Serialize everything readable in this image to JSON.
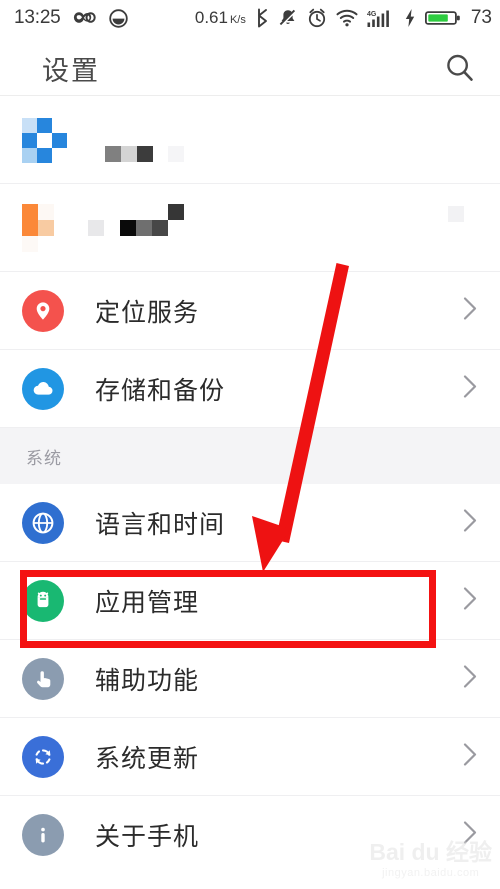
{
  "statusbar": {
    "clock": "13:25",
    "left_icons": [
      "infinity-icon",
      "smiley-icon"
    ],
    "net_speed": "0.61",
    "net_speed_unit": "K/s",
    "right_icons": [
      "bluetooth-icon",
      "mute-icon",
      "alarm-icon",
      "wifi-icon",
      "signal-4g-icon",
      "charging-bolt-icon"
    ],
    "signal_label": "4G",
    "battery_percent": "73",
    "battery_color": "#2ecc40"
  },
  "titlebar": {
    "title": "设置",
    "search_icon": "search-icon"
  },
  "list": [
    {
      "kind": "mosaic",
      "name": "censored-row-1",
      "icon_colors": [
        "#c8e0f7",
        "#2786dd",
        "#ffffff",
        "#2786dd",
        "#ffffff",
        "#2786dd",
        "#a9d1f2",
        "#2786dd",
        "#ffffff"
      ],
      "text_blocks": [
        "#808080",
        "#d4d4d4",
        "#3c3c3c",
        "#f5f5f7"
      ]
    },
    {
      "kind": "mosaic",
      "name": "censored-row-2",
      "icon_colors": [
        "#fb8838",
        "#fdf8f4",
        "#ffffff",
        "#fb8838",
        "#f8cba2",
        "#ffffff",
        "#fdf9f6",
        "#ffffff",
        "#ffffff"
      ],
      "text_blocks": [
        "#e8e8ea",
        "#0a0a0a",
        "#6f6f6f",
        "#474747",
        "#363636"
      ],
      "chevron_block": "#f2f2f4"
    },
    {
      "kind": "item",
      "name": "location-services",
      "label": "定位服务",
      "icon": "location-pin-icon",
      "icon_bg": "#f4524d",
      "chevron": "chevron-right-icon"
    },
    {
      "kind": "item",
      "name": "storage-and-backup",
      "label": "存储和备份",
      "icon": "cloud-icon",
      "icon_bg": "#2196e3",
      "chevron": "chevron-right-icon"
    },
    {
      "kind": "section",
      "name": "section-system",
      "label": "系统"
    },
    {
      "kind": "item",
      "name": "language-and-time",
      "label": "语言和时间",
      "icon": "globe-icon",
      "icon_bg": "#2f6fd0",
      "chevron": "chevron-right-icon"
    },
    {
      "kind": "item",
      "name": "app-management",
      "label": "应用管理",
      "icon": "android-robot-icon",
      "icon_bg": "#19b872",
      "chevron": "chevron-right-icon",
      "highlighted": true
    },
    {
      "kind": "item",
      "name": "accessibility",
      "label": "辅助功能",
      "icon": "hand-pointer-icon",
      "icon_bg": "#8b9cb0",
      "chevron": "chevron-right-icon"
    },
    {
      "kind": "item",
      "name": "system-update",
      "label": "系统更新",
      "icon": "refresh-icon",
      "icon_bg": "#3a6fd8",
      "chevron": "chevron-right-icon"
    },
    {
      "kind": "item",
      "name": "about-phone",
      "label": "关于手机",
      "icon": "info-icon",
      "icon_bg": "#8b9cb0",
      "chevron": "chevron-right-icon"
    }
  ],
  "annotations": {
    "color": "#f41212",
    "arrow": "red-arrow-down-left",
    "highlight_target": "app-management"
  },
  "watermark": {
    "main": "Bai du 经验",
    "sub": "jingyan.baidu.com"
  }
}
